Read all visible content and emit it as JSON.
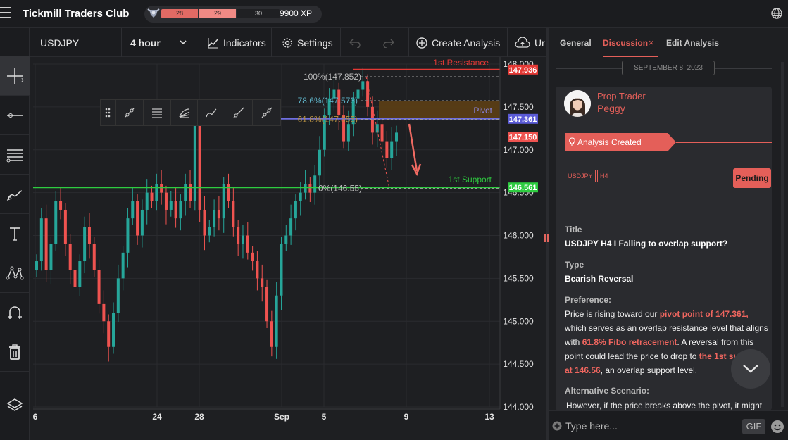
{
  "app": {
    "title": "Tickmill Traders Club"
  },
  "xp": {
    "level_left": "28",
    "level_mid": "29",
    "level_right": "30",
    "points": "9900 XP"
  },
  "toolbar": {
    "symbol": "USDJPY",
    "interval": "4 hour",
    "indicators": "Indicators",
    "settings": "Settings",
    "create_analysis": "Create Analysis",
    "upload": "Ur"
  },
  "chart": {
    "price_labels": [
      "148.000",
      "147.500",
      "147.000",
      "146.500",
      "146.000",
      "145.500",
      "145.000",
      "144.500",
      "144.000"
    ],
    "date_labels": [
      "6",
      "24",
      "28",
      "Sep",
      "5",
      "9",
      "13"
    ],
    "resistance_label": "1st Resistance",
    "resistance_price": "147.936",
    "pivot_label": "Pivot",
    "pivot_price": "147.361",
    "current_price": "147.150",
    "support_label": "1st Support",
    "support_price": "146.561",
    "fib_100": "100%(147.852)",
    "fib_786": "78.6%(147.573)",
    "fib_618": "61.8%(147.355)",
    "fib_0": "0%(146.55)",
    "colors": {
      "up": "#26a69a",
      "down": "#ef5350",
      "resistance": "#e53935",
      "support": "#2ecc40",
      "pivot": "#6f6fe0"
    }
  },
  "chart_data": {
    "type": "candlestick",
    "symbol": "USDJPY",
    "interval": "4 hour",
    "ylim": [
      144.0,
      148.0
    ],
    "y_ticks": [
      148.0,
      147.5,
      147.0,
      146.5,
      146.0,
      145.5,
      145.0,
      144.5,
      144.0
    ],
    "x_ticks": [
      "6",
      "24",
      "28",
      "Sep",
      "5",
      "9",
      "13"
    ],
    "levels": [
      {
        "name": "1st Resistance",
        "value": 147.936
      },
      {
        "name": "Pivot",
        "value": 147.361
      },
      {
        "name": "current",
        "value": 147.15
      },
      {
        "name": "1st Support",
        "value": 146.561
      }
    ],
    "fibonacci": [
      {
        "level": "100%",
        "value": 147.852
      },
      {
        "level": "78.6%",
        "value": 147.573
      },
      {
        "level": "61.8%",
        "value": 147.355
      },
      {
        "level": "0%",
        "value": 146.55
      }
    ],
    "closes": [
      145.7,
      146.2,
      145.6,
      145.9,
      146.4,
      146.3,
      145.9,
      145.6,
      145.4,
      145.7,
      146.1,
      145.9,
      145.6,
      145.2,
      145.0,
      144.7,
      145.1,
      145.5,
      145.8,
      146.2,
      146.4,
      146.0,
      146.3,
      146.5,
      146.4,
      146.6,
      146.5,
      146.3,
      146.4,
      146.2,
      146.4,
      146.6,
      146.4,
      147.3,
      146.3,
      146.0,
      146.1,
      146.3,
      146.2,
      146.6,
      146.4,
      146.1,
      145.9,
      146.0,
      145.8,
      145.7,
      145.5,
      145.4,
      145.0,
      144.7,
      145.3,
      145.9,
      146.0,
      146.2,
      146.4,
      146.5,
      146.6,
      146.5,
      146.7,
      147.0,
      147.4,
      147.6,
      147.7,
      147.4,
      147.1,
      147.3,
      147.6,
      147.7,
      147.8,
      147.5,
      147.2,
      147.3,
      147.1,
      146.9,
      147.1,
      147.2
    ]
  },
  "right_panel": {
    "tabs": [
      "General",
      "Discussion",
      "Edit Analysis"
    ],
    "date": "SEPTEMBER 8, 2023",
    "author_role": "Prop Trader",
    "author_name": "Peggy",
    "created_label": "Analysis Created",
    "tag_symbol": "USDJPY",
    "tag_interval": "H4",
    "status": "Pending",
    "title_label": "Title",
    "title_value": "USDJPY H4 I Falling to overlap support?",
    "type_label": "Type",
    "type_value": "Bearish Reversal",
    "preference_label": "Preference:",
    "pref_text_1": "Price is rising toward our ",
    "pref_hl_1": "pivot point of 147.361,",
    "pref_text_2": " which serves as an overlap resistance level that aligns with ",
    "pref_hl_2": "61.8% Fibo retracement",
    "pref_text_3": ".  A reversal from this point could lead the price to drop to ",
    "pref_hl_3": "the 1st support at 146.56",
    "pref_text_4": ", an overlap support level.",
    "alt_label": "Alternative Scenario:",
    "alt_text": " However, if the price breaks above the pivot, it might"
  },
  "compose": {
    "placeholder": "Type here...",
    "gif": "GIF"
  }
}
